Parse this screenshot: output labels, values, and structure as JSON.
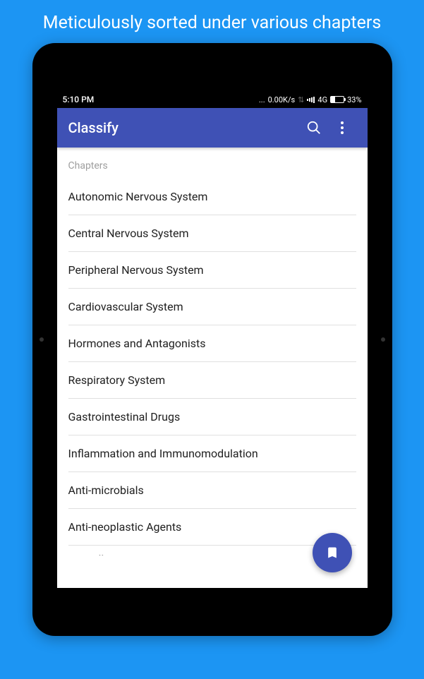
{
  "promo": {
    "headline": "Meticulously sorted under various chapters"
  },
  "status_bar": {
    "time": "5:10 PM",
    "data_rate": "0.00K/s",
    "network": "4G",
    "battery_pct": "33%"
  },
  "app_bar": {
    "title": "Classify"
  },
  "content": {
    "section_label": "Chapters",
    "chapters": [
      "Autonomic Nervous System",
      "Central Nervous System",
      "Peripheral Nervous System",
      "Cardiovascular System",
      "Hormones and Antagonists",
      "Respiratory System",
      "Gastrointestinal Drugs",
      "Inflammation and Immunomodulation",
      "Anti-microbials",
      "Anti-neoplastic Agents"
    ],
    "partial_chapter": "Miscell"
  }
}
